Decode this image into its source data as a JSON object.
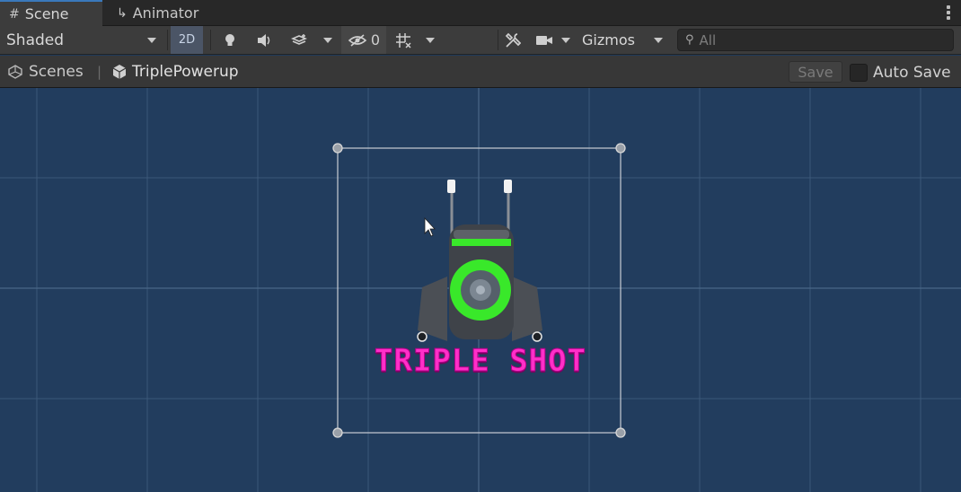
{
  "tabs": [
    {
      "label": "Scene",
      "icon": "grid-icon",
      "active": true
    },
    {
      "label": "Animator",
      "icon": "animator-icon",
      "active": false
    }
  ],
  "toolbar": {
    "shading_mode": "Shaded",
    "mode_2d": "2D",
    "hidden_count": "0",
    "gizmos_label": "Gizmos",
    "search_placeholder": "All"
  },
  "breadcrumb": {
    "root": "Scenes",
    "prefab": "TriplePowerup"
  },
  "prefab_bar": {
    "save_label": "Save",
    "autosave_label": "Auto Save",
    "autosave_checked": false
  },
  "scene": {
    "sprite_text": "TRIPLE SHOT",
    "text_color": "#ff2fc8",
    "glow_color": "#39e82a",
    "background_color": "#223d5e"
  }
}
